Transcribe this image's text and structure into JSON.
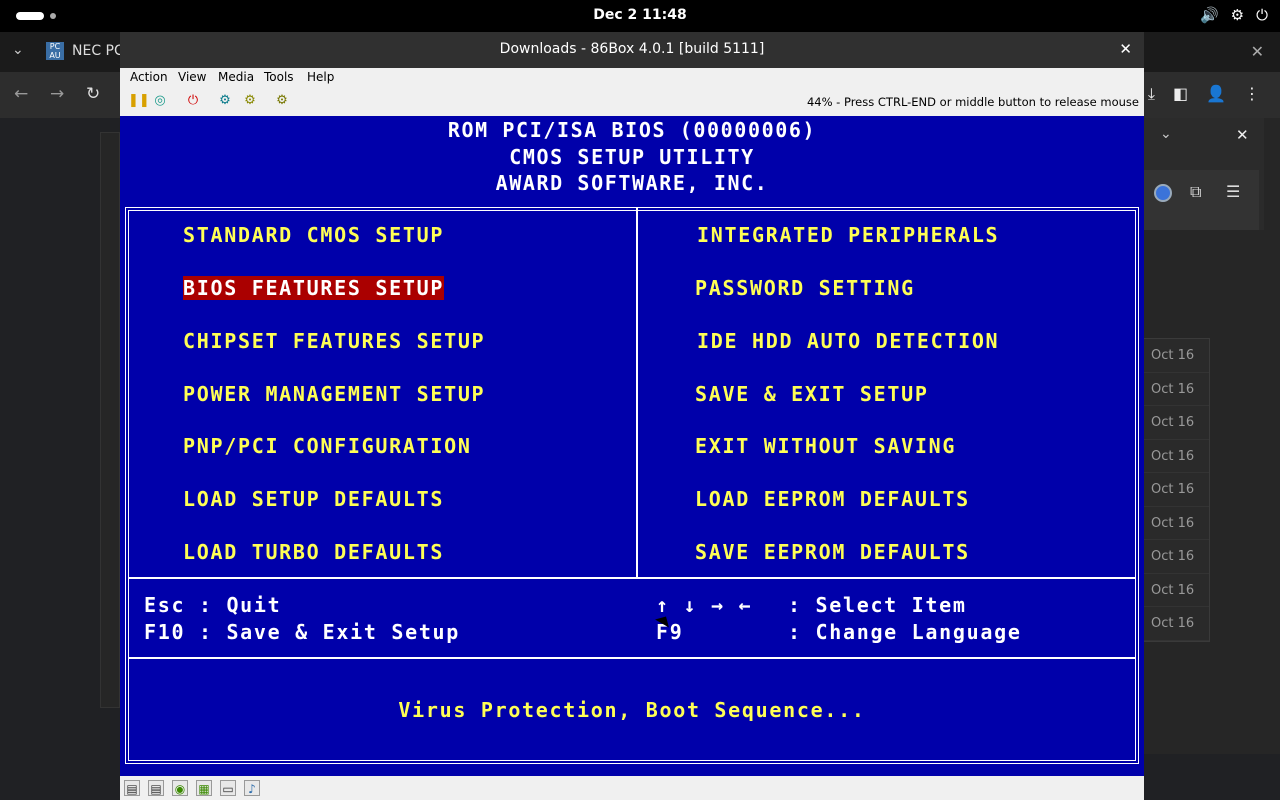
{
  "system": {
    "clock": "Dec 2  11:48",
    "icons": [
      "volume-icon",
      "settings-icon",
      "power-icon"
    ]
  },
  "browser": {
    "tab_title": "NEC PC",
    "favicon_text": "PC AU",
    "dates": [
      "Oct 16",
      "Oct 16",
      "Oct 16",
      "Oct 16",
      "Oct 16",
      "Oct 16",
      "Oct 16",
      "Oct 16",
      "Oct 16"
    ]
  },
  "vm_window": {
    "title": "Downloads - 86Box 4.0.1 [build 5111]",
    "menu": [
      "Action",
      "View",
      "Media",
      "Tools",
      "Help"
    ],
    "status_text": "44% - Press CTRL-END or middle button to release mouse"
  },
  "bios": {
    "header": [
      "ROM PCI/ISA BIOS (00000006)",
      "CMOS SETUP UTILITY",
      "AWARD SOFTWARE, INC."
    ],
    "left_items": [
      "STANDARD CMOS SETUP",
      "BIOS FEATURES SETUP",
      "CHIPSET FEATURES SETUP",
      "POWER MANAGEMENT SETUP",
      "PNP/PCI CONFIGURATION",
      "LOAD SETUP DEFAULTS",
      "LOAD TURBO DEFAULTS"
    ],
    "right_items": [
      "INTEGRATED PERIPHERALS",
      "PASSWORD SETTING",
      "IDE HDD AUTO DETECTION",
      "SAVE & EXIT SETUP",
      "EXIT WITHOUT SAVING",
      "LOAD EEPROM DEFAULTS",
      "SAVE EEPROM DEFAULTS"
    ],
    "selected_item": "BIOS FEATURES SETUP",
    "keys": {
      "esc": "Esc : Quit",
      "f10": "F10 : Save & Exit Setup",
      "arrows": "↑ ↓ → ←",
      "arrows_desc": ": Select Item",
      "f9": "F9",
      "f9_desc": ": Change Language"
    },
    "hint": "Virus Protection, Boot Sequence..."
  },
  "colors": {
    "bios_bg": "#0000aa",
    "bios_item": "#ffff55",
    "bios_selected_bg": "#aa0000"
  }
}
